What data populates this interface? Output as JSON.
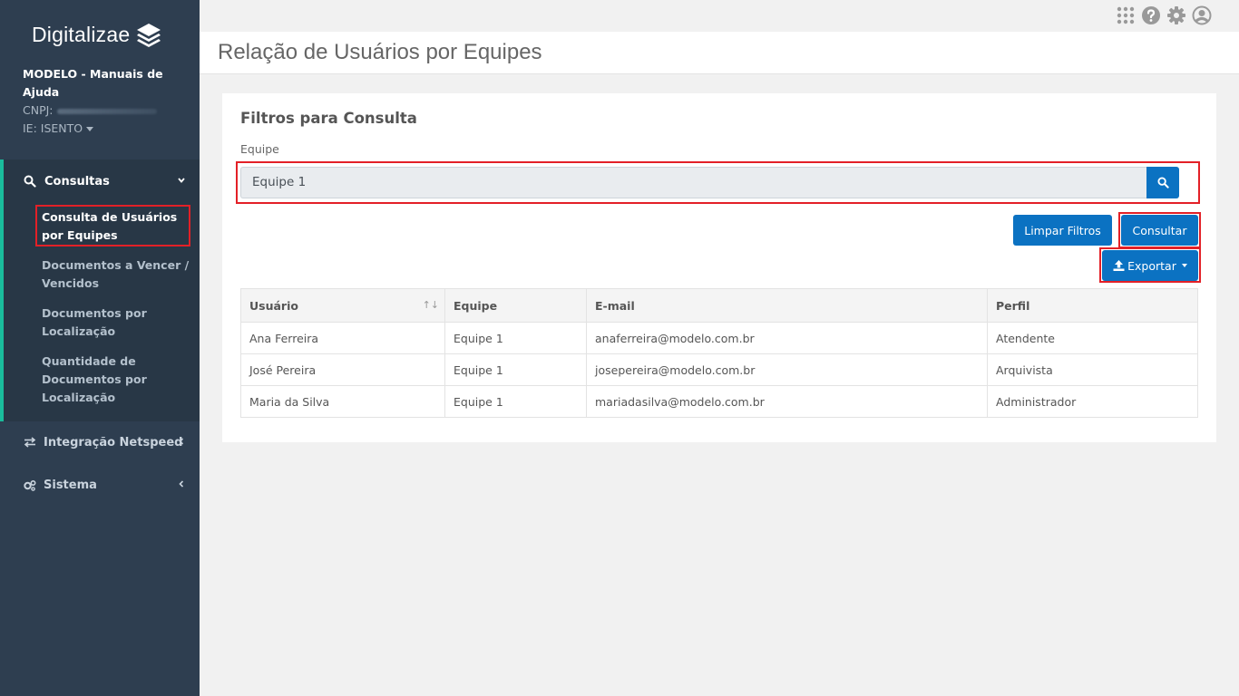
{
  "brand": {
    "name": "Digitalizae"
  },
  "company": {
    "name": "MODELO - Manuais de Ajuda",
    "cnpj_label": "CNPJ:",
    "ie": "IE: ISENTO"
  },
  "sidebar": {
    "consultas": {
      "label": "Consultas",
      "items": [
        {
          "label": "Consulta de Usuários por Equipes"
        },
        {
          "label": "Documentos a Vencer / Vencidos"
        },
        {
          "label": "Documentos por Localização"
        },
        {
          "label": "Quantidade de Documentos por Localização"
        }
      ]
    },
    "integracao": {
      "label": "Integração Netspeed"
    },
    "sistema": {
      "label": "Sistema"
    }
  },
  "topbar": {
    "icons": [
      "apps-grid-icon",
      "help-icon",
      "settings-icon",
      "user-icon"
    ]
  },
  "page": {
    "title": "Relação de Usuários por Equipes"
  },
  "filters": {
    "title": "Filtros para Consulta",
    "team_label": "Equipe",
    "team_value": "Equipe 1",
    "clear_label": "Limpar Filtros",
    "query_label": "Consultar",
    "export_label": "Exportar"
  },
  "table": {
    "headers": [
      "Usuário",
      "Equipe",
      "E-mail",
      "Perfil"
    ],
    "rows": [
      [
        "Ana Ferreira",
        "Equipe 1",
        "anaferreira@modelo.com.br",
        "Atendente"
      ],
      [
        "José Pereira",
        "Equipe 1",
        "josepereira@modelo.com.br",
        "Arquivista"
      ],
      [
        "Maria da Silva",
        "Equipe 1",
        "mariadasilva@modelo.com.br",
        "Administrador"
      ]
    ]
  },
  "colors": {
    "sidebar": "#2e3e50",
    "accent": "#0b72c2",
    "highlight": "#e32027",
    "menu_border": "#1abc9c"
  }
}
